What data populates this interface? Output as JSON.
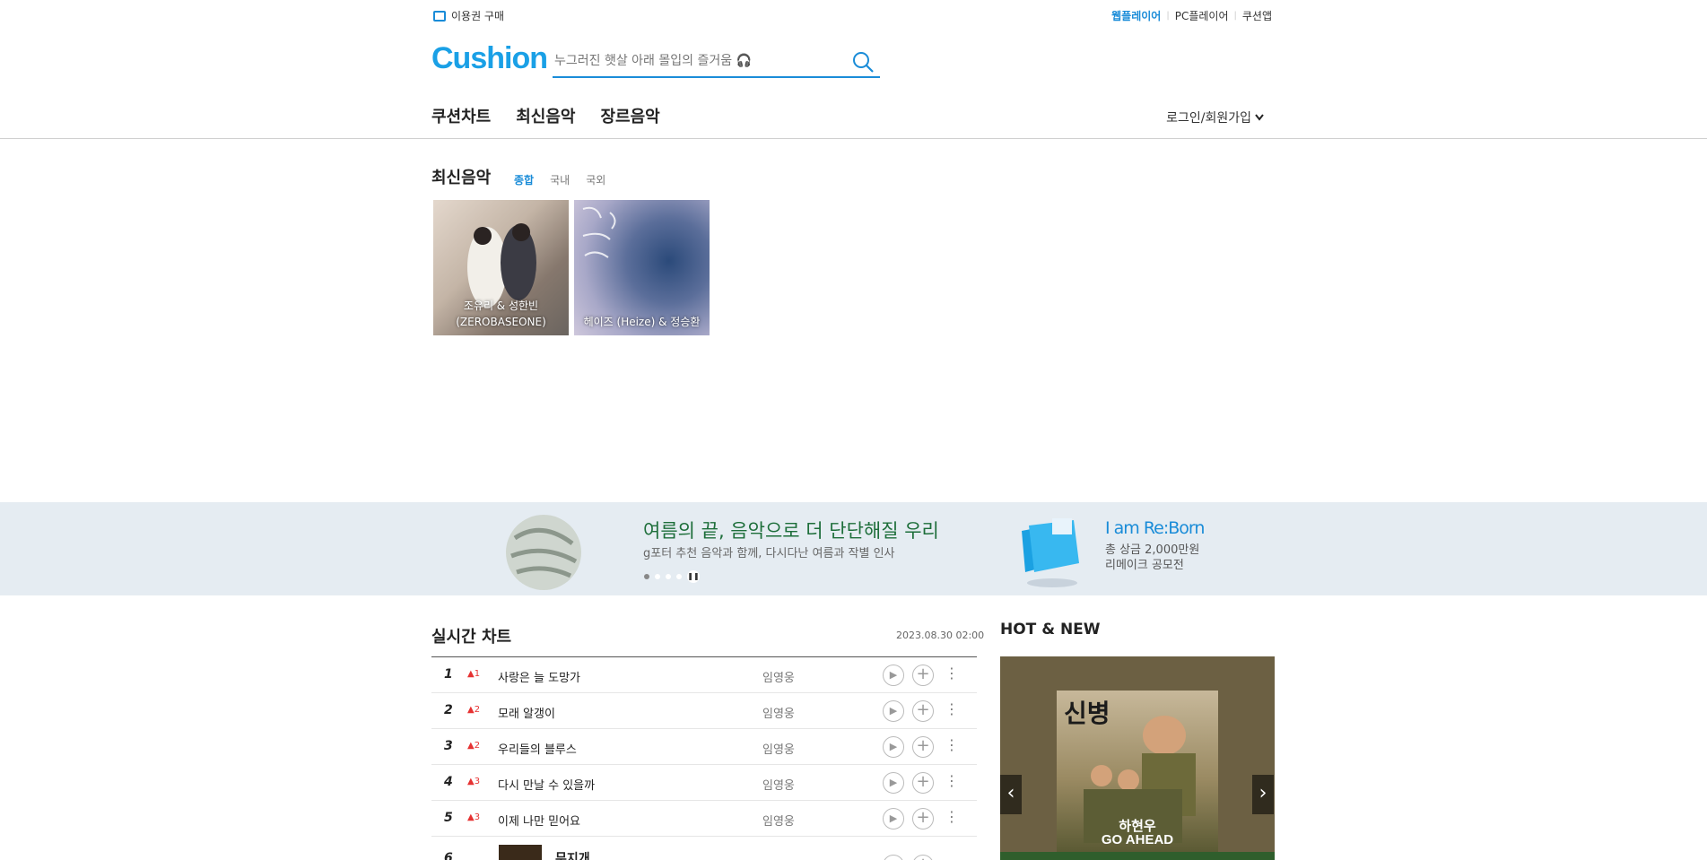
{
  "topbar": {
    "buy_label": "이용권 구매",
    "links": [
      "웹플레이어",
      "PC플레이어",
      "쿠션앱"
    ]
  },
  "logo": "Cushion",
  "search": {
    "placeholder": "누그러진 햇살 아래 몰입의 즐거움 🎧"
  },
  "gnb": [
    "쿠션차트",
    "최신음악",
    "장르음악"
  ],
  "login_label": "로그인/회원가입",
  "new_music": {
    "title": "최신음악",
    "tabs": [
      "종합",
      "국내",
      "국외"
    ],
    "albums": [
      {
        "caption": "조유리 & 성한빈 (ZEROBASEONE)"
      },
      {
        "caption": "헤이즈 (Heize) & 정승환"
      }
    ]
  },
  "banner": {
    "left_title": "여름의 끝, 음악으로 더 단단해질 우리",
    "left_sub": "g포터 추천 음악과 함께, 다시다난 여름과 작별 인사",
    "right_title": "I am Re:Born",
    "right_sub1": "총 상금 2,000만원",
    "right_sub2": "리메이크 공모전"
  },
  "realtime": {
    "title": "실시간 차트",
    "timestamp": "2023.08.30  02:00",
    "rows": [
      {
        "rank": "1",
        "change": "▲1",
        "song": "사랑은 늘 도망가",
        "artist": "임영웅"
      },
      {
        "rank": "2",
        "change": "▲2",
        "song": "모래 알갱이",
        "artist": "임영웅"
      },
      {
        "rank": "3",
        "change": "▲2",
        "song": "우리들의 블루스",
        "artist": "임영웅"
      },
      {
        "rank": "4",
        "change": "▲3",
        "song": "다시 만날 수 있을까",
        "artist": "임영웅"
      },
      {
        "rank": "5",
        "change": "▲3",
        "song": "이제 나만 믿어요",
        "artist": "임영웅"
      },
      {
        "rank": "6",
        "change": "",
        "song": "무지개",
        "artist": ""
      }
    ]
  },
  "hot_new": {
    "title": "HOT & NEW",
    "album_title": "신병",
    "album_artist": "하현우",
    "album_song": "GO AHEAD"
  }
}
